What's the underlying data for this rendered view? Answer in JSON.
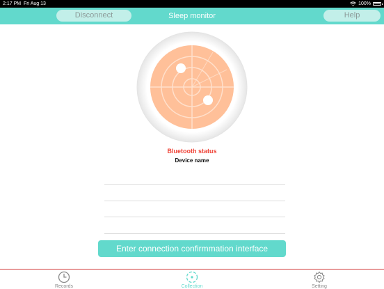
{
  "status_bar": {
    "time": "2:17 PM",
    "date": "Fri Aug 13",
    "battery": "100%",
    "icons": [
      "wifi-icon",
      "battery-icon"
    ]
  },
  "nav": {
    "disconnect_label": "Disconnect",
    "title": "Sleep monitor",
    "help_label": "Help"
  },
  "main": {
    "bluetooth_status": "Bluetooth status",
    "device_name": "Device name",
    "device_list": [
      "",
      "",
      "",
      ""
    ],
    "connect_label": "Enter connection confirmmation interface"
  },
  "tabs": [
    {
      "label": "Records",
      "icon": "clock-icon",
      "active": false
    },
    {
      "label": "Collection",
      "icon": "radar-scan-icon",
      "active": true
    },
    {
      "label": "Setting",
      "icon": "gear-icon",
      "active": false
    }
  ],
  "colors": {
    "accent": "#62d9cc",
    "nav_button": "#c2efe9",
    "status_red": "#ef4236",
    "radar_orange": "#ffc099"
  }
}
